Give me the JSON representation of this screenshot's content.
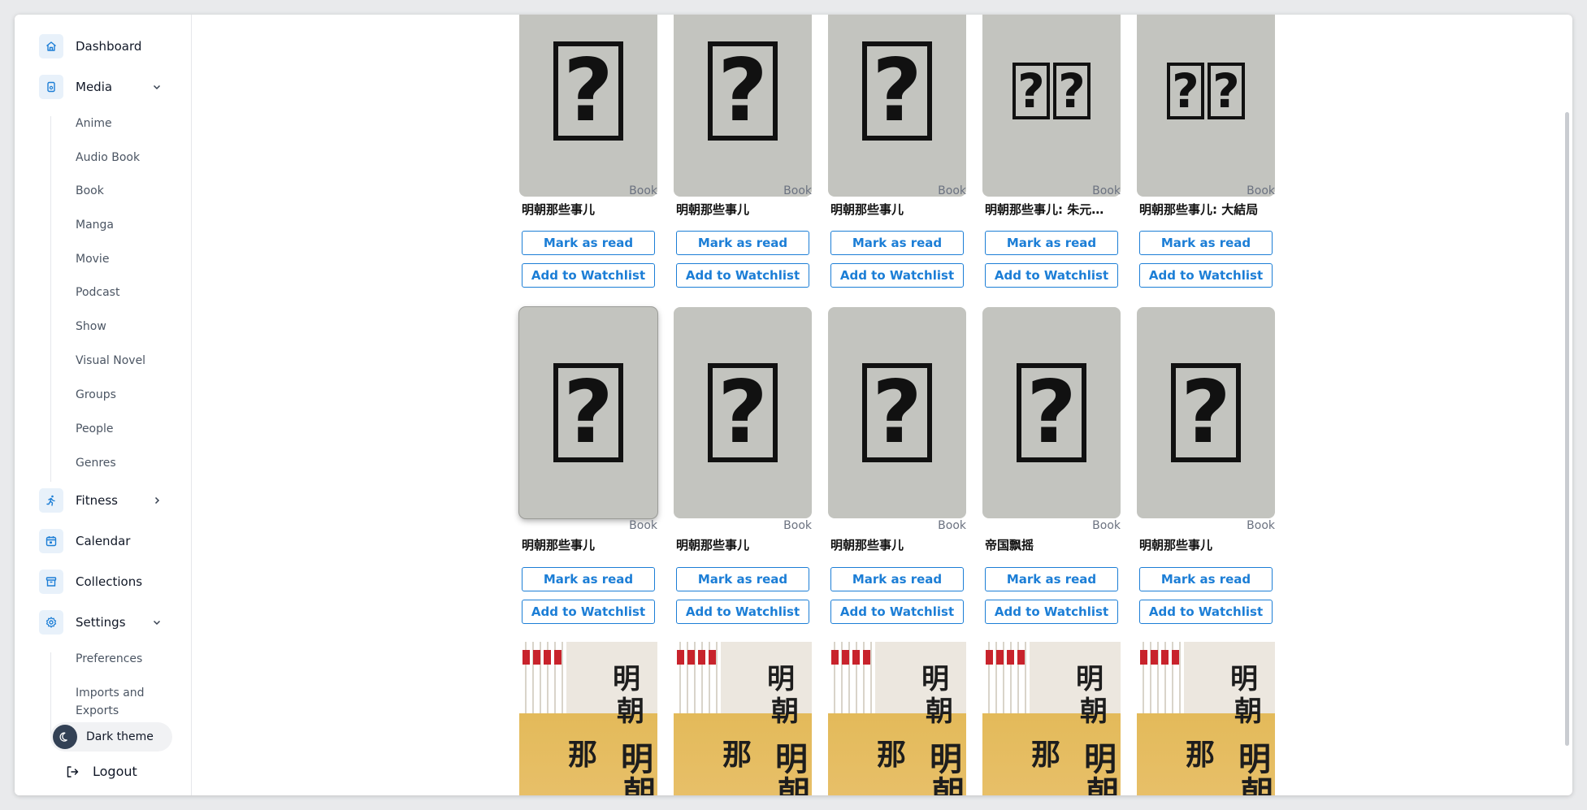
{
  "sidebar": {
    "items": [
      {
        "label": "Dashboard",
        "icon": "home-icon"
      },
      {
        "label": "Media",
        "icon": "media-icon",
        "expanded": true
      },
      {
        "label": "Fitness",
        "icon": "running-icon",
        "expanded": false
      },
      {
        "label": "Calendar",
        "icon": "calendar-icon"
      },
      {
        "label": "Collections",
        "icon": "archive-icon"
      },
      {
        "label": "Settings",
        "icon": "gear-icon",
        "expanded": true
      }
    ],
    "media_sub": [
      "Anime",
      "Audio Book",
      "Book",
      "Manga",
      "Movie",
      "Podcast",
      "Show",
      "Visual Novel",
      "Groups",
      "People",
      "Genres"
    ],
    "settings_sub": [
      "Preferences",
      "Imports and Exports"
    ],
    "theme_label": "Dark theme",
    "logout_label": "Logout"
  },
  "cards": {
    "type_label": "Book",
    "mark_read_label": "Mark as read",
    "watchlist_label": "Add to Watchlist",
    "row1": [
      "明朝那些事儿",
      "明朝那些事儿",
      "明朝那些事儿",
      "明朝那些事儿: 朱元…",
      "明朝那些事儿: 大結局"
    ],
    "row2": [
      "明朝那些事儿",
      "明朝那些事儿",
      "明朝那些事儿",
      "帝国飘摇",
      "明朝那些事儿"
    ]
  },
  "colors": {
    "accent": "#1c7ed6",
    "icon_bg": "#e8f1fa",
    "placeholder_bg": "#c3c4bf"
  }
}
